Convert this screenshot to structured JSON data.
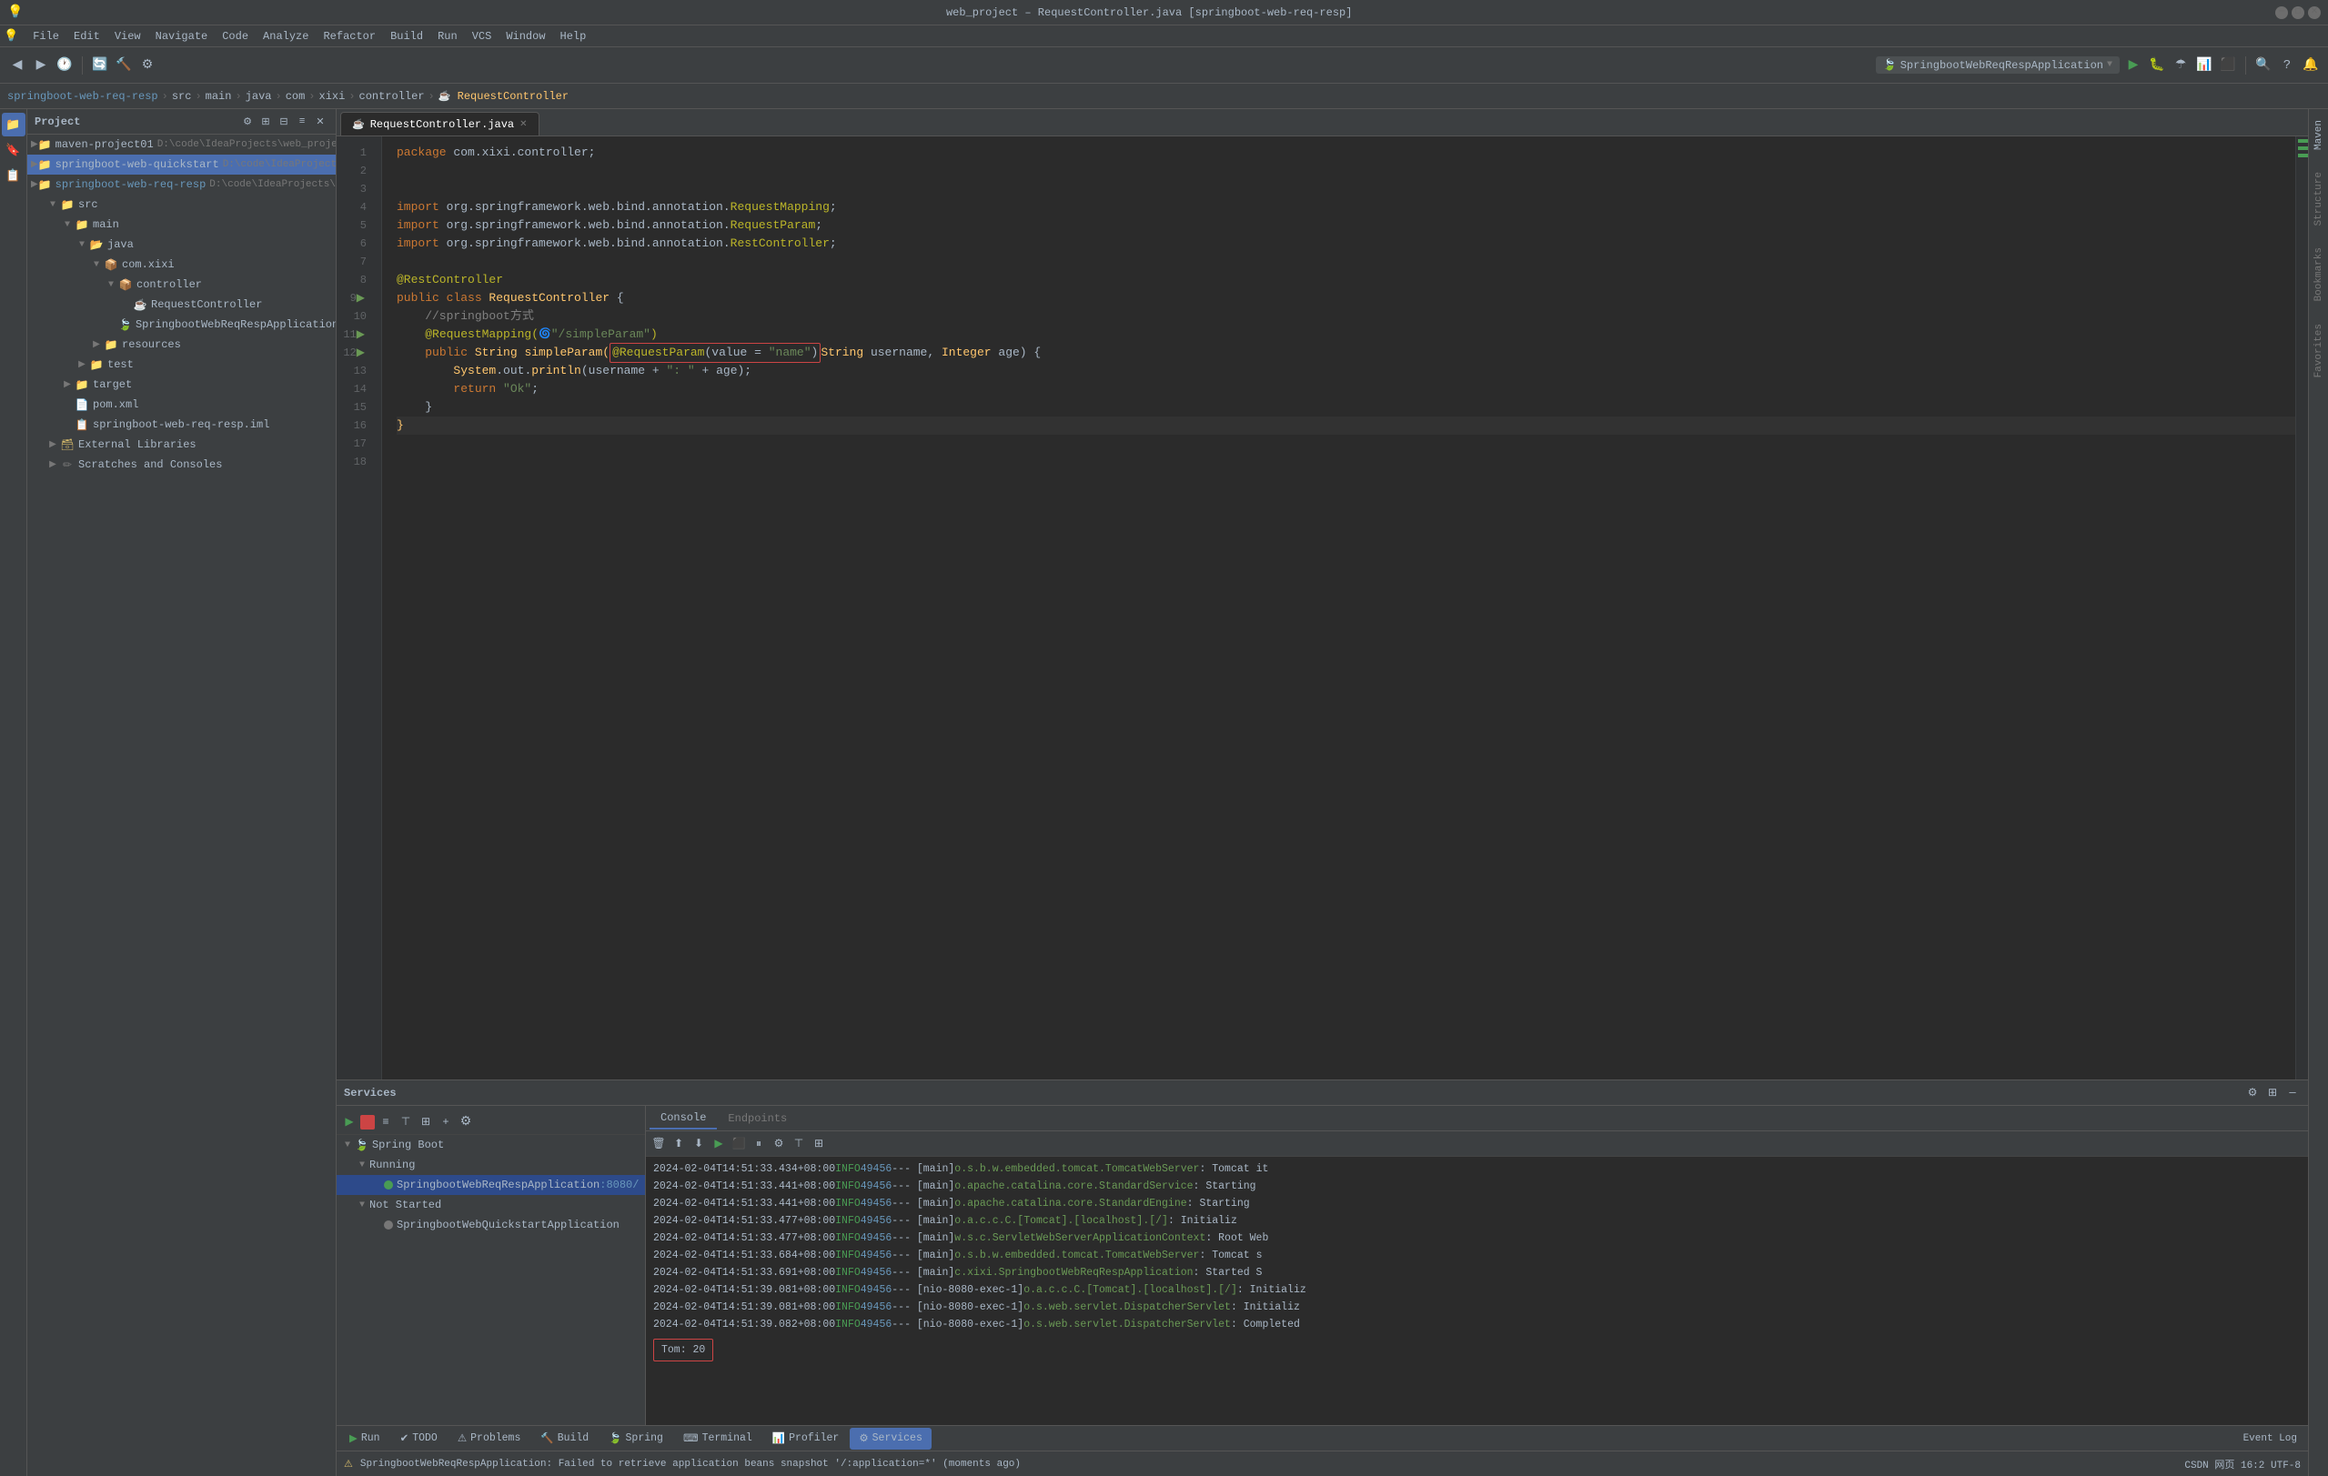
{
  "titlebar": {
    "title": "web_project – RequestController.java [springboot-web-req-resp]",
    "minimize": "─",
    "maximize": "□",
    "close": "✕"
  },
  "menu": {
    "items": [
      "File",
      "Edit",
      "View",
      "Navigate",
      "Code",
      "Analyze",
      "Refactor",
      "Build",
      "Run",
      "VCS",
      "Window",
      "Help"
    ]
  },
  "breadcrumb": {
    "items": [
      "springboot-web-req-resp",
      "src",
      "main",
      "java",
      "com",
      "xixi",
      "controller",
      "RequestController"
    ]
  },
  "project_panel": {
    "title": "Project",
    "items": [
      {
        "label": "Project",
        "indent": 0,
        "arrow": "",
        "icon": "📁"
      },
      {
        "label": "maven-project01",
        "indent": 1,
        "arrow": "▶",
        "path": "D:\\code\\IdeaProjects\\web_project\\maven-pro"
      },
      {
        "label": "springboot-web-quickstart",
        "indent": 1,
        "arrow": "▶",
        "path": "D:\\code\\IdeaProjects\\web_proje",
        "selected": true
      },
      {
        "label": "springboot-web-req-resp",
        "indent": 1,
        "arrow": "▶",
        "path": "D:\\code\\IdeaProjects\\web_proje"
      },
      {
        "label": "src",
        "indent": 2,
        "arrow": "▼"
      },
      {
        "label": "main",
        "indent": 3,
        "arrow": "▼"
      },
      {
        "label": "java",
        "indent": 4,
        "arrow": "▼"
      },
      {
        "label": "com.xixi",
        "indent": 5,
        "arrow": "▼"
      },
      {
        "label": "controller",
        "indent": 6,
        "arrow": "▼"
      },
      {
        "label": "RequestController",
        "indent": 7,
        "icon": "☕"
      },
      {
        "label": "SpringbootWebReqRespApplication",
        "indent": 7,
        "icon": "🍃"
      },
      {
        "label": "resources",
        "indent": 5,
        "arrow": "▶"
      },
      {
        "label": "test",
        "indent": 4,
        "arrow": "▶"
      },
      {
        "label": "target",
        "indent": 3,
        "arrow": "▶"
      },
      {
        "label": "pom.xml",
        "indent": 3,
        "icon": "📄"
      },
      {
        "label": "springboot-web-req-resp.iml",
        "indent": 3,
        "icon": "📋"
      },
      {
        "label": "External Libraries",
        "indent": 2,
        "arrow": "▶"
      },
      {
        "label": "Scratches and Consoles",
        "indent": 2,
        "arrow": "▶"
      }
    ]
  },
  "editor": {
    "tab": "RequestController.java",
    "lines": [
      {
        "num": 1,
        "code": "package com.xixi.controller;"
      },
      {
        "num": 2,
        "code": ""
      },
      {
        "num": 3,
        "code": ""
      },
      {
        "num": 4,
        "code": "import org.springframework.web.bind.annotation.RequestMapping;"
      },
      {
        "num": 5,
        "code": "import org.springframework.web.bind.annotation.RequestParam;"
      },
      {
        "num": 6,
        "code": "import org.springframework.web.bind.annotation.RestController;"
      },
      {
        "num": 7,
        "code": ""
      },
      {
        "num": 8,
        "code": "@RestController"
      },
      {
        "num": 9,
        "code": "public class RequestController {"
      },
      {
        "num": 10,
        "code": "    //springboot方式"
      },
      {
        "num": 11,
        "code": "    @RequestMapping(\"/simpleParam\")"
      },
      {
        "num": 12,
        "code": "    public String simpleParam(@RequestParam(value = \"name\")String username, Integer age) {"
      },
      {
        "num": 13,
        "code": "        System.out.println(username + \": \" + age);"
      },
      {
        "num": 14,
        "code": "        return \"Ok\";"
      },
      {
        "num": 15,
        "code": "    }"
      },
      {
        "num": 16,
        "code": "}"
      },
      {
        "num": 17,
        "code": ""
      },
      {
        "num": 18,
        "code": ""
      }
    ]
  },
  "run_config": {
    "name": "SpringbootWebReqRespApplication"
  },
  "services": {
    "title": "Services",
    "tree": [
      {
        "label": "Spring Boot",
        "indent": 0,
        "arrow": "▼",
        "icon": "🍃"
      },
      {
        "label": "Running",
        "indent": 1,
        "arrow": "▼"
      },
      {
        "label": "SpringbootWebReqRespApplication :8080/",
        "indent": 2,
        "arrow": "",
        "running": true
      },
      {
        "label": "Not Started",
        "indent": 1,
        "arrow": "▼"
      },
      {
        "label": "SpringbootWebQuickstartApplication",
        "indent": 2,
        "arrow": "",
        "running": false
      }
    ]
  },
  "console_tabs": [
    "Console",
    "Endpoints"
  ],
  "log_lines": [
    {
      "ts": "2024-02-04T14:51:33.434+08:00",
      "level": "INFO",
      "pid": "49456",
      "sep": "---",
      "thread": "main]",
      "logger": "o.s.b.w.embedded.tomcat.TomcatWebServer",
      "msg": ": Tomcat it"
    },
    {
      "ts": "2024-02-04T14:51:33.441+08:00",
      "level": "INFO",
      "pid": "49456",
      "sep": "---",
      "thread": "main]",
      "logger": "o.apache.catalina.core.StandardService",
      "msg": ": Starting"
    },
    {
      "ts": "2024-02-04T14:51:33.441+08:00",
      "level": "INFO",
      "pid": "49456",
      "sep": "---",
      "thread": "main]",
      "logger": "o.apache.catalina.core.StandardEngine",
      "msg": ": Starting"
    },
    {
      "ts": "2024-02-04T14:51:33.477+08:00",
      "level": "INFO",
      "pid": "49456",
      "sep": "---",
      "thread": "main]",
      "logger": "o.a.c.c.C.[Tomcat].[localhost].[/]",
      "msg": ": Initializ"
    },
    {
      "ts": "2024-02-04T14:51:33.477+08:00",
      "level": "INFO",
      "pid": "49456",
      "sep": "---",
      "thread": "main]",
      "logger": "w.s.c.ServletWebServerApplicationContext",
      "msg": ": Root Web"
    },
    {
      "ts": "2024-02-04T14:51:33.684+08:00",
      "level": "INFO",
      "pid": "49456",
      "sep": "---",
      "thread": "main]",
      "logger": "o.s.b.w.embedded.tomcat.TomcatWebServer",
      "msg": ": Tomcat s"
    },
    {
      "ts": "2024-02-04T14:51:33.691+08:00",
      "level": "INFO",
      "pid": "49456",
      "sep": "---",
      "thread": "main]",
      "logger": "c.xixi.SpringbootWebReqRespApplication",
      "msg": ": Started S"
    },
    {
      "ts": "2024-02-04T14:51:39.081+08:00",
      "level": "INFO",
      "pid": "49456",
      "sep": "---",
      "thread": "[nio-8080-exec-1]",
      "logger": "o.a.c.c.C.[Tomcat].[localhost].[/]",
      "msg": ": Initializ"
    },
    {
      "ts": "2024-02-04T14:51:39.081+08:00",
      "level": "INFO",
      "pid": "49456",
      "sep": "---",
      "thread": "[nio-8080-exec-1]",
      "logger": "o.s.web.servlet.DispatcherServlet",
      "msg": ": Initializ"
    },
    {
      "ts": "2024-02-04T14:51:39.082+08:00",
      "level": "INFO",
      "pid": "49456",
      "sep": "---",
      "thread": "[nio-8080-exec-1]",
      "logger": "o.s.web.servlet.DispatcherServlet",
      "msg": ": Completed"
    }
  ],
  "log_result": "Tom: 20",
  "bottom_tabs": [
    {
      "label": "▶ Run",
      "active": false
    },
    {
      "label": "✔ TODO",
      "active": false
    },
    {
      "label": "⚠ Problems",
      "active": false
    },
    {
      "label": "🔨 Build",
      "active": false
    },
    {
      "label": "🍃 Spring",
      "active": false
    },
    {
      "label": "⌨ Terminal",
      "active": false
    },
    {
      "label": "📊 Profiler",
      "active": false
    },
    {
      "label": "⚙ Services",
      "active": true
    }
  ],
  "status_bar": {
    "left": "SpringbootWebReqRespApplication: Failed to retrieve application beans snapshot '/:application=*' (moments ago)",
    "right": "CSDN 网页  16:2  UTF-8"
  },
  "right_tabs": [
    "Maven",
    "Structure",
    "Bookmarks",
    "Favorites"
  ]
}
